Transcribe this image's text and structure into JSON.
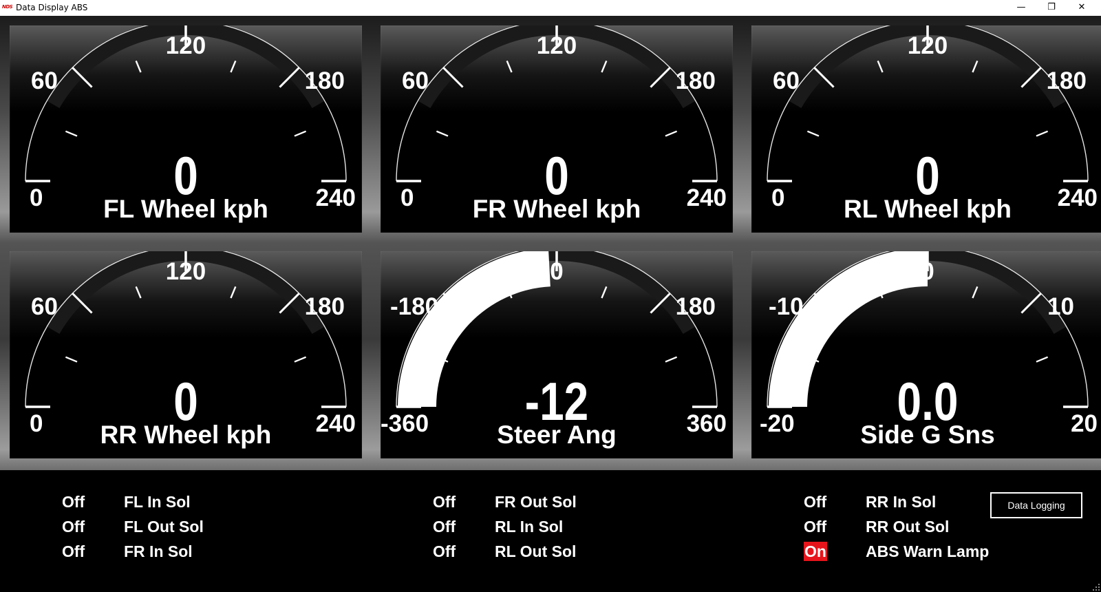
{
  "window": {
    "title": "Data Display ABS",
    "icon_text": "NDS",
    "controls": [
      "minimize-icon",
      "restore-icon",
      "close-icon"
    ]
  },
  "colors": {
    "background": "#000000",
    "title_bar": "#ffffff",
    "gauge_fill": "#ffffff",
    "warning_on": "#e8141b"
  },
  "gauges": [
    {
      "name": "FL Wheel kph",
      "value": "0",
      "min": 0,
      "max": 240,
      "ticks": [
        "0",
        "60",
        "120",
        "180",
        "240"
      ],
      "reading": 0
    },
    {
      "name": "FR Wheel kph",
      "value": "0",
      "min": 0,
      "max": 240,
      "ticks": [
        "0",
        "60",
        "120",
        "180",
        "240"
      ],
      "reading": 0
    },
    {
      "name": "RL Wheel kph",
      "value": "0",
      "min": 0,
      "max": 240,
      "ticks": [
        "0",
        "60",
        "120",
        "180",
        "240"
      ],
      "reading": 0
    },
    {
      "name": "RR Wheel kph",
      "value": "0",
      "min": 0,
      "max": 240,
      "ticks": [
        "0",
        "60",
        "120",
        "180",
        "240"
      ],
      "reading": 0
    },
    {
      "name": "Steer Ang",
      "value": "-12",
      "min": -360,
      "max": 360,
      "ticks": [
        "-360",
        "-180",
        "0",
        "180",
        "360"
      ],
      "reading": -12
    },
    {
      "name": "Side G Sns",
      "value": "0.0",
      "min": -20,
      "max": 20,
      "ticks": [
        "-20",
        "-10",
        "0",
        "10",
        "20"
      ],
      "reading": 0
    }
  ],
  "status_columns": [
    [
      {
        "state": "Off",
        "label": "FL In Sol"
      },
      {
        "state": "Off",
        "label": "FL Out Sol"
      },
      {
        "state": "Off",
        "label": "FR In Sol"
      }
    ],
    [
      {
        "state": "Off",
        "label": "FR Out Sol"
      },
      {
        "state": "Off",
        "label": "RL In Sol"
      },
      {
        "state": "Off",
        "label": "RL Out Sol"
      }
    ],
    [
      {
        "state": "Off",
        "label": "RR In Sol"
      },
      {
        "state": "Off",
        "label": "RR Out Sol"
      },
      {
        "state": "On",
        "label": "ABS Warn Lamp"
      }
    ]
  ],
  "buttons": {
    "data_logging": "Data Logging"
  }
}
